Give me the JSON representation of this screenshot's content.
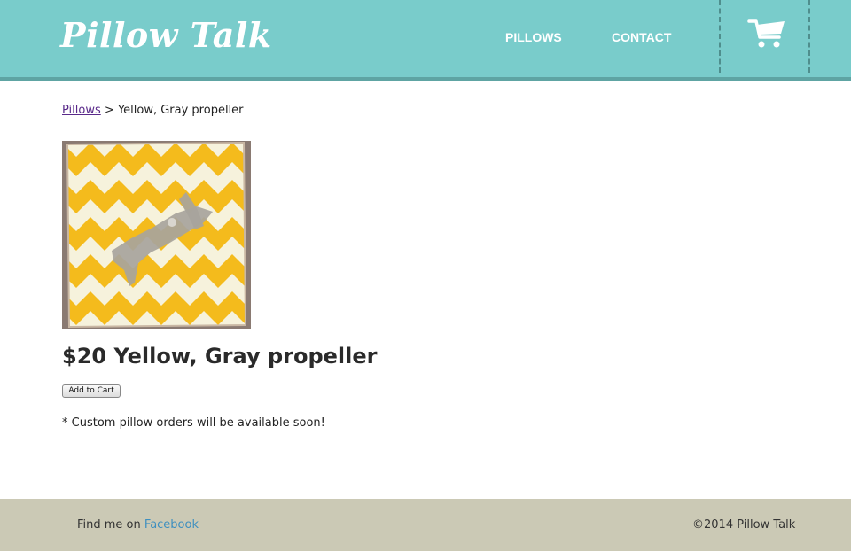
{
  "header": {
    "logo": "Pillow Talk",
    "nav": {
      "pillows": "PILLOWS",
      "contact": "CONTACT"
    },
    "cart_icon": "shopping-cart-icon"
  },
  "breadcrumb": {
    "link": "Pillows",
    "separator": ">",
    "current": "Yellow, Gray propeller"
  },
  "product": {
    "image_icon": "pillow-photo",
    "price": "$20",
    "name": "Yellow, Gray propeller",
    "add_to_cart": "Add to Cart",
    "note": "* Custom pillow orders will be available soon!"
  },
  "footer": {
    "find_prefix": "Find me on",
    "facebook": "Facebook",
    "copyright": "©2014 Pillow Talk"
  },
  "colors": {
    "header_bg": "#79cccb",
    "footer_bg": "#cbc9b5",
    "link_purple": "#5a2a8a",
    "facebook_blue": "#3e8fbf",
    "pillow_yellow": "#f4bb1c"
  }
}
